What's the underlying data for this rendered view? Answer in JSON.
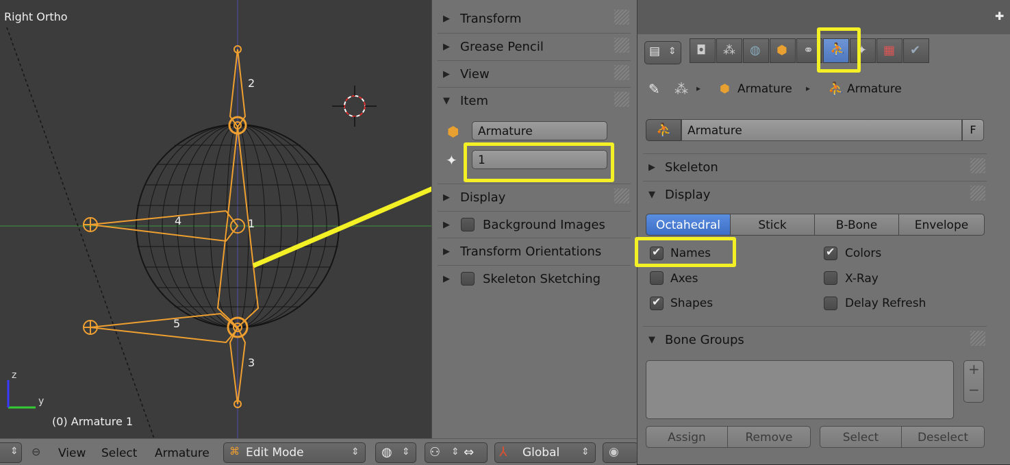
{
  "viewport": {
    "view_name": "Right Ortho",
    "status": "(0) Armature 1",
    "bone_labels": [
      "2",
      "1",
      "4",
      "5",
      "3"
    ],
    "axis_y_label": "y",
    "axis_z_label": "z"
  },
  "header": {
    "menu": [
      "View",
      "Select",
      "Armature"
    ],
    "mode": "Edit Mode",
    "orientation": "Global"
  },
  "npanel": {
    "panels": [
      {
        "label": "Transform",
        "expanded": false
      },
      {
        "label": "Grease Pencil",
        "expanded": false
      },
      {
        "label": "View",
        "expanded": false
      },
      {
        "label": "Item",
        "expanded": true
      },
      {
        "label": "Display",
        "expanded": false
      },
      {
        "label": "Background Images",
        "expanded": false,
        "checkbox": true
      },
      {
        "label": "Transform Orientations",
        "expanded": false
      },
      {
        "label": "Skeleton Sketching",
        "expanded": false,
        "checkbox": true
      }
    ],
    "item_object_name": "Armature",
    "item_bone_name": "1"
  },
  "properties": {
    "breadcrumb": [
      "Armature",
      "Armature"
    ],
    "datablock_name": "Armature",
    "fake_user": "F",
    "skeleton_label": "Skeleton",
    "display_label": "Display",
    "display_types": [
      "Octahedral",
      "Stick",
      "B-Bone",
      "Envelope"
    ],
    "active_display_type": "Octahedral",
    "options": [
      {
        "label": "Names",
        "checked": true
      },
      {
        "label": "Colors",
        "checked": true
      },
      {
        "label": "Axes",
        "checked": false
      },
      {
        "label": "X-Ray",
        "checked": false
      },
      {
        "label": "Shapes",
        "checked": true
      },
      {
        "label": "Delay Refresh",
        "checked": false
      }
    ],
    "bone_groups_label": "Bone Groups",
    "bone_group_buttons": [
      "Assign",
      "Remove",
      "Select",
      "Deselect"
    ],
    "list_add": "+",
    "list_remove": "−"
  },
  "colors": {
    "bone": "#f0a030",
    "highlight": "#f3f026",
    "accent": "#4f78bd"
  }
}
